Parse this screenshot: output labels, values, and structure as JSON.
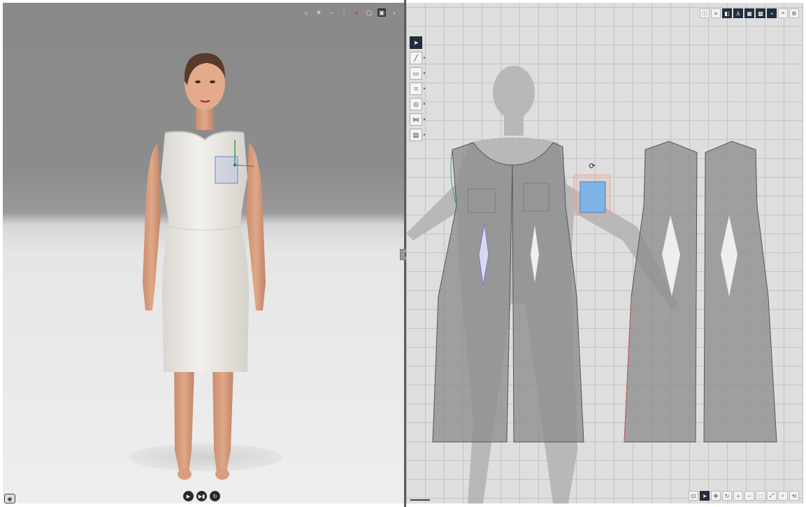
{
  "colors": {
    "viewport_bg_top": "#8a8a8a",
    "viewport_floor": "#eeeeee",
    "grid_bg": "#dedede",
    "grid_line": "#c2c2c2",
    "pattern_fill": "#8f8f8f",
    "selection_blue": "#7fb3e6",
    "toolbar_active": "#1f2f3f"
  },
  "viewport3d": {
    "toolbar_icons": [
      "light-icon",
      "star-icon",
      "minus-icon",
      "pin-icon",
      "red-dot-icon",
      "cube-icon",
      "display-icon",
      "arrow-icon"
    ],
    "playback_icons": [
      "play-icon",
      "next-frame-icon",
      "reset-icon"
    ],
    "camera_icon": "camera-icon"
  },
  "view2d": {
    "tools": [
      {
        "icon": "select-arrow-icon",
        "active": true
      },
      {
        "icon": "line-pen-icon",
        "active": false
      },
      {
        "icon": "rectangle-icon",
        "active": false
      },
      {
        "icon": "sewing-icon",
        "active": false
      },
      {
        "icon": "button-icon",
        "active": false
      },
      {
        "icon": "zipper-icon",
        "active": false
      },
      {
        "icon": "measure-icon",
        "active": false
      }
    ],
    "top_toolbar": [
      {
        "icon": "info-icon",
        "active": false
      },
      {
        "icon": "layer-icon",
        "active": false
      },
      {
        "icon": "view-pattern-icon",
        "active": true
      },
      {
        "icon": "view-avatar-icon",
        "active": true
      },
      {
        "icon": "view-fabric-icon",
        "active": true
      },
      {
        "icon": "view-grid-icon",
        "active": true
      },
      {
        "icon": "view-sewing-icon",
        "active": true
      },
      {
        "icon": "pin-icon",
        "active": false
      },
      {
        "icon": "settings-icon",
        "active": false
      }
    ],
    "bottom_toolbar": [
      {
        "icon": "fit-icon",
        "active": false
      },
      {
        "icon": "select-icon",
        "active": true
      },
      {
        "icon": "move-icon",
        "active": false
      },
      {
        "icon": "rotate-icon",
        "active": false
      },
      {
        "icon": "zoom-in-icon",
        "active": false
      },
      {
        "icon": "zoom-out-icon",
        "active": false
      },
      {
        "icon": "zoom-window-icon",
        "active": false
      },
      {
        "icon": "expand-icon",
        "active": false
      },
      {
        "icon": "search-icon",
        "active": false
      },
      {
        "icon": "reset-view-icon",
        "active": false
      }
    ],
    "rotate_icon": "rotate-handle-icon"
  }
}
